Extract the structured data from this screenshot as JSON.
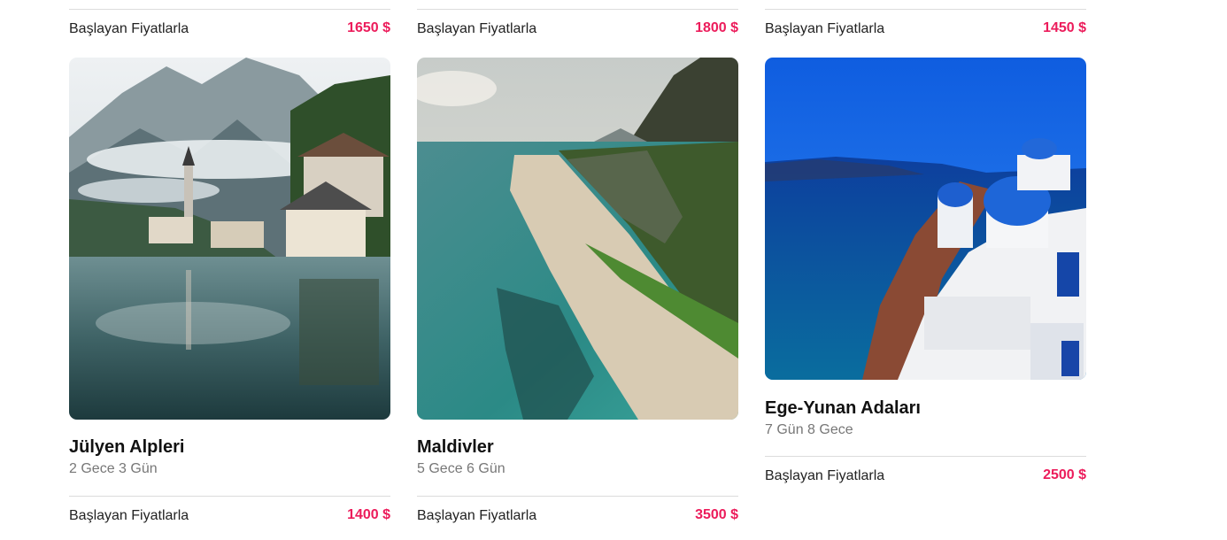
{
  "top_row": [
    {
      "label": "Başlayan Fiyatlarla",
      "price": "1650 $"
    },
    {
      "label": "Başlayan Fiyatlarla",
      "price": "1800 $"
    },
    {
      "label": "Başlayan Fiyatlarla",
      "price": "1450 $"
    }
  ],
  "cards": [
    {
      "image": "hallstatt-alpine-village-lake-photo",
      "title": "Jülyen Alpleri",
      "duration": "2 Gece 3 Gün",
      "price_label": "Başlayan Fiyatlarla",
      "price": "1400 $"
    },
    {
      "image": "tropical-beach-aerial-photo",
      "title": "Maldivler",
      "duration": "5 Gece 6 Gün",
      "price_label": "Başlayan Fiyatlarla",
      "price": "3500 $"
    },
    {
      "image": "santorini-blue-domes-photo",
      "title": "Ege-Yunan Adaları",
      "duration": "7 Gün 8 Gece",
      "price_label": "Başlayan Fiyatlarla",
      "price": "2500 $"
    }
  ],
  "colors": {
    "price": "#ec1c5b",
    "divider": "#dcdcdc",
    "subtitle": "#777777"
  }
}
